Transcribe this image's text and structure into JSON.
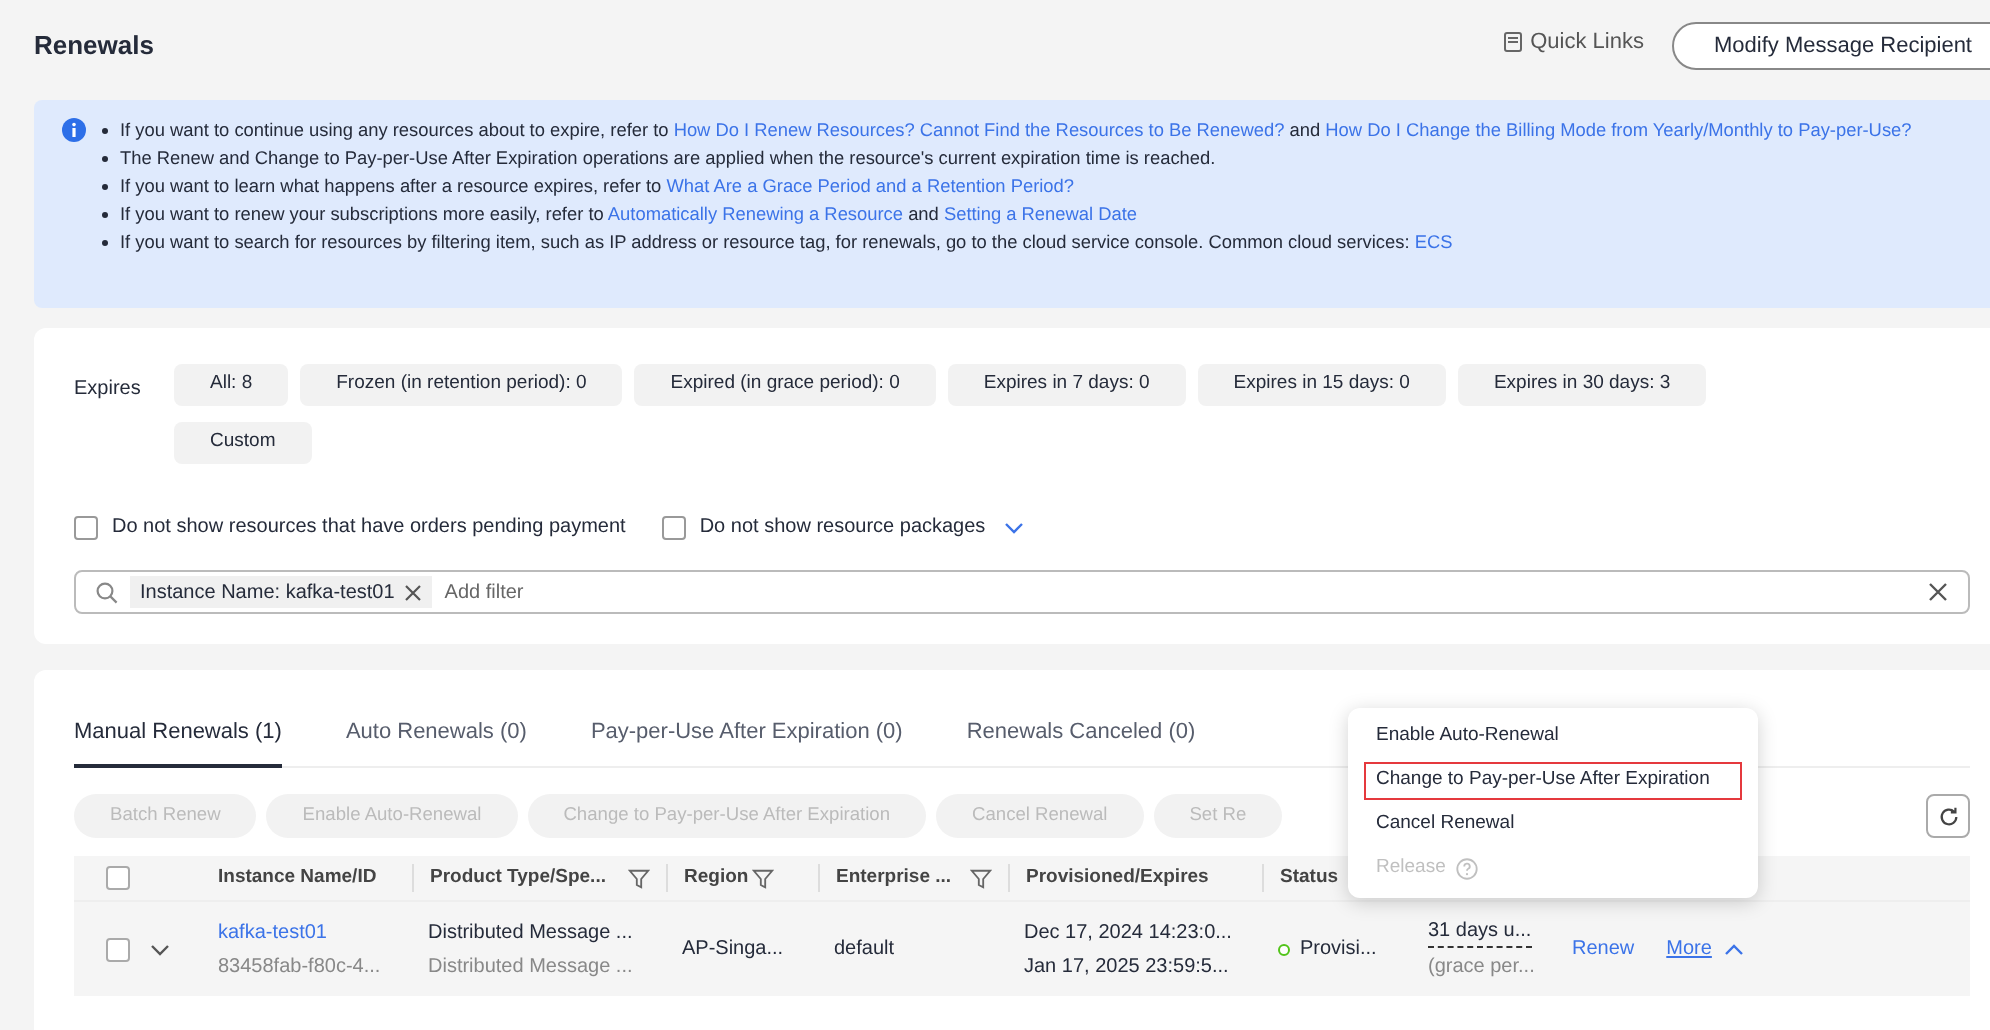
{
  "header": {
    "title": "Renewals",
    "quick_links": "Quick Links",
    "modify_button": "Modify Message Recipient"
  },
  "notice": [
    [
      {
        "kind": "text",
        "text": "If you want to continue using any resources about to expire, refer to "
      },
      {
        "kind": "link",
        "text": "How Do I Renew Resources? Cannot Find the Resources to Be Renewed?"
      },
      {
        "kind": "text",
        "text": " and "
      },
      {
        "kind": "link",
        "text": "How Do I Change the Billing Mode from Yearly/Monthly to Pay-per-Use?"
      }
    ],
    [
      {
        "kind": "text",
        "text": "The Renew and Change to Pay-per-Use After Expiration operations are applied when the resource's current expiration time is reached."
      }
    ],
    [
      {
        "kind": "text",
        "text": "If you want to learn what happens after a resource expires, refer to "
      },
      {
        "kind": "link",
        "text": "What Are a Grace Period and a Retention Period?"
      }
    ],
    [
      {
        "kind": "text",
        "text": "If you want to renew your subscriptions more easily, refer to "
      },
      {
        "kind": "link",
        "text": "Automatically Renewing a Resource"
      },
      {
        "kind": "text",
        "text": " and "
      },
      {
        "kind": "link",
        "text": "Setting a Renewal Date"
      }
    ],
    [
      {
        "kind": "text",
        "text": "If you want to search for resources by filtering item, such as IP address or resource tag, for renewals, go to the cloud service console. Common cloud services: "
      },
      {
        "kind": "link",
        "text": "ECS"
      }
    ]
  ],
  "filters": {
    "label": "Expires",
    "chips": [
      "All: 8",
      "Frozen (in retention period): 0",
      "Expired (in grace period): 0",
      "Expires in 7 days: 0",
      "Expires in 15 days: 0",
      "Expires in 30 days: 3",
      "Custom"
    ],
    "options": [
      {
        "label": "Do not show resources that have orders pending payment",
        "checked": false
      },
      {
        "label": "Do not show resource packages",
        "checked": false
      }
    ],
    "search": {
      "tag": "Instance Name: kafka-test01",
      "placeholder": "Add filter"
    }
  },
  "tabs": [
    {
      "label": "Manual Renewals (1)",
      "selected": true
    },
    {
      "label": "Auto Renewals (0)",
      "selected": false
    },
    {
      "label": "Pay-per-Use After Expiration (0)",
      "selected": false
    },
    {
      "label": "Renewals Canceled (0)",
      "selected": false
    }
  ],
  "toolbar": [
    {
      "label": "Batch Renew",
      "disabled": true
    },
    {
      "label": "Enable Auto-Renewal",
      "disabled": true
    },
    {
      "label": "Change to Pay-per-Use After Expiration",
      "disabled": true
    },
    {
      "label": "Cancel Renewal",
      "disabled": true
    },
    {
      "label": "Set Re",
      "disabled": true
    }
  ],
  "table": {
    "header_checked": false,
    "columns": [
      {
        "label": "Instance Name/ID",
        "filter": false
      },
      {
        "label": "Product Type/Spe...",
        "filter": true
      },
      {
        "label": "Region",
        "filter": true
      },
      {
        "label": "Enterprise ...",
        "filter": true
      },
      {
        "label": "Provisioned/Expires",
        "filter": false
      },
      {
        "label": "Status"
      }
    ],
    "rows": [
      {
        "checked": false,
        "expanded": false,
        "name": "kafka-test01",
        "id": "83458fab-f80c-4...",
        "product": "Distributed Message ...",
        "spec": "Distributed Message ...",
        "region": "AP-Singa...",
        "enterprise": "default",
        "provisioned": "Dec 17, 2024 14:23:0...",
        "expires": "Jan 17, 2025 23:59:5...",
        "status": "Provisi...",
        "color": "#52c41a",
        "remaining": "31 days u...",
        "remaining_note": "(grace per...",
        "actions": [
          "Renew",
          "More"
        ]
      }
    ]
  },
  "menu": [
    {
      "label": "Enable Auto-Renewal",
      "disabled": false,
      "highlighted": false
    },
    {
      "label": "Change to Pay-per-Use After Expiration",
      "disabled": false,
      "highlighted": true
    },
    {
      "label": "Cancel Renewal",
      "disabled": false,
      "highlighted": false
    },
    {
      "label": "Release",
      "disabled": true,
      "highlighted": false
    }
  ]
}
